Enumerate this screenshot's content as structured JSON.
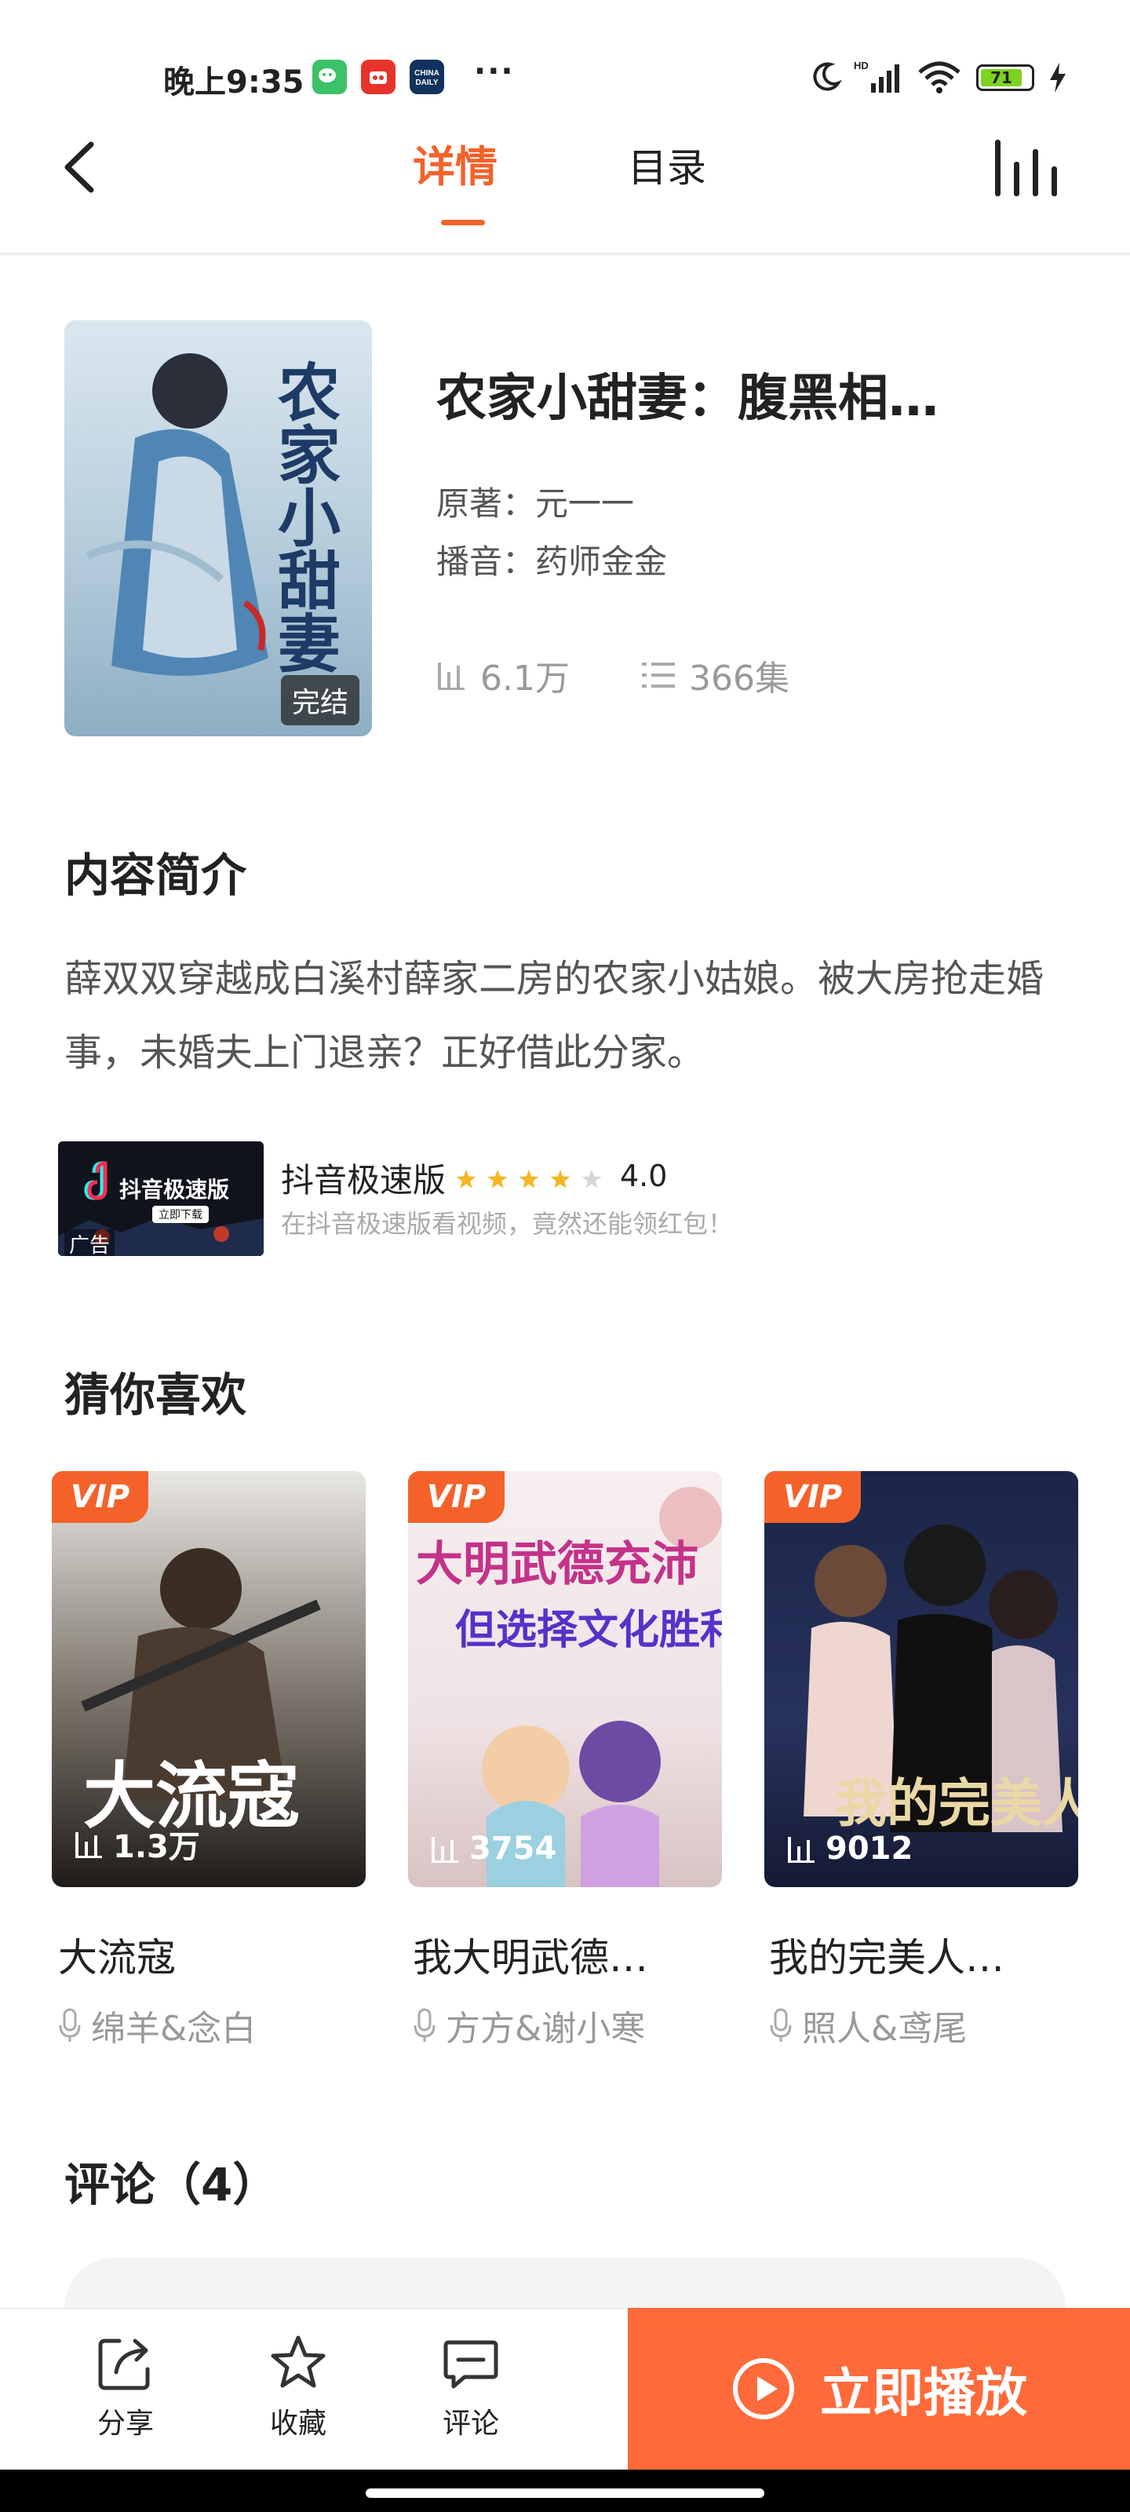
{
  "status_bar": {
    "time": "晚上9:35",
    "more": "···",
    "battery": "71",
    "app_icons": [
      {
        "name": "wechat-mini-icon",
        "color": "#3cc26a"
      },
      {
        "name": "news-app-icon",
        "color": "#e8332a"
      },
      {
        "name": "china-daily-icon",
        "label": "CHINA DAILY",
        "color": "#12325e"
      }
    ]
  },
  "nav": {
    "tabs": [
      {
        "label": "详情"
      },
      {
        "label": "目录"
      }
    ]
  },
  "book": {
    "title": "农家小甜妻：腹黑相…",
    "author_label": "原著：",
    "author": "元一一",
    "narrator_label": "播音：",
    "narrator": "药师金金",
    "plays": "6.1万",
    "episodes": "366集",
    "status_badge": "完结",
    "cover_text": "农家小甜妻"
  },
  "intro": {
    "title": "内容简介",
    "text": "薛双双穿越成白溪村薛家二房的农家小姑娘。被大房抢走婚事，未婚夫上门退亲？正好借此分家。"
  },
  "ad": {
    "image_title": "抖音极速版",
    "image_button": "立即下载",
    "tag": "广告",
    "name": "抖音极速版",
    "rating": "4.0",
    "stars": 4,
    "description": "在抖音极速版看视频，竟然还能领红包！"
  },
  "recommend": {
    "title": "猜你喜欢",
    "items": [
      {
        "vip": "VIP",
        "cover_text": "大流寇",
        "plays": "1.3万",
        "title": "大流寇",
        "voice": "绵羊&念白"
      },
      {
        "vip": "VIP",
        "cover_text": "大明武德充沛",
        "cover_sub": "但选择文化胜利",
        "plays": "3754",
        "title": "我大明武德…",
        "voice": "方方&谢小寒"
      },
      {
        "vip": "VIP",
        "cover_text": "我的完美人生啊",
        "plays": "9012",
        "title": "我的完美人…",
        "voice": "照人&鸢尾"
      }
    ]
  },
  "comments": {
    "title": "评论（4）"
  },
  "bottom_bar": {
    "share": "分享",
    "favorite": "收藏",
    "comment": "评论",
    "play": "立即播放"
  },
  "colors": {
    "accent": "#f4622a",
    "play_button": "#fe6a3a"
  }
}
